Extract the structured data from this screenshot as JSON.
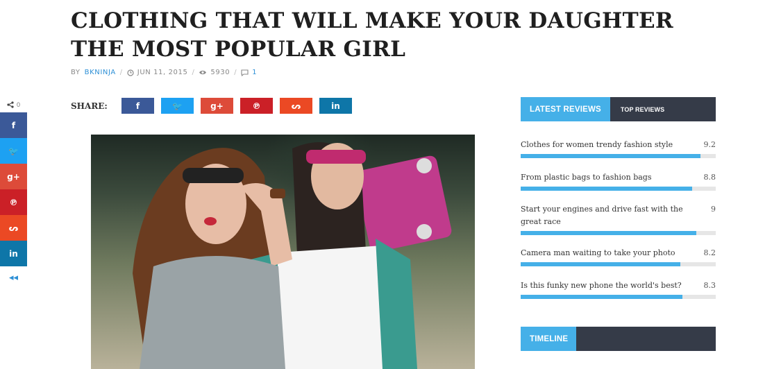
{
  "article": {
    "title": "CLOTHING THAT WILL MAKE YOUR DAUGHTER THE MOST POPULAR GIRL",
    "meta": {
      "by_label": "BY",
      "author": "BKNINJA",
      "date": "JUN 11, 2015",
      "views": "5930",
      "comments": "1",
      "separator": "/"
    }
  },
  "float_share": {
    "count": "0",
    "buttons": [
      {
        "name": "facebook",
        "glyph": "f",
        "color": "#3b5998"
      },
      {
        "name": "twitter",
        "glyph": "🐦",
        "color": "#1da1f2"
      },
      {
        "name": "googleplus",
        "glyph": "g+",
        "color": "#dd4b39"
      },
      {
        "name": "pinterest",
        "glyph": "℗",
        "color": "#cb2027"
      },
      {
        "name": "stumbleupon",
        "glyph": "ᔕ",
        "color": "#eb4924"
      },
      {
        "name": "linkedin",
        "glyph": "in",
        "color": "#0e76a8"
      }
    ],
    "collapse_glyph": "◂◂"
  },
  "share": {
    "label": "SHARE:",
    "buttons": [
      {
        "name": "facebook",
        "glyph": "f",
        "color": "#3b5998"
      },
      {
        "name": "twitter",
        "glyph": "🐦",
        "color": "#1da1f2"
      },
      {
        "name": "googleplus",
        "glyph": "g+",
        "color": "#dd4b39"
      },
      {
        "name": "pinterest",
        "glyph": "℗",
        "color": "#cb2027"
      },
      {
        "name": "stumbleupon",
        "glyph": "ᔕ",
        "color": "#eb4924"
      },
      {
        "name": "linkedin",
        "glyph": "in",
        "color": "#0e76a8"
      }
    ]
  },
  "sidebar": {
    "reviews_widget": {
      "tab_active": "LATEST REVIEWS",
      "tab_inactive": "TOP REVIEWS",
      "items": [
        {
          "title": "Clothes for women trendy fashion style",
          "score": "9.2",
          "fill": 0.92
        },
        {
          "title": "From plastic bags to fashion bags",
          "score": "8.8",
          "fill": 0.88
        },
        {
          "title": "Start your engines and drive fast with the great race",
          "score": "9",
          "fill": 0.9
        },
        {
          "title": "Camera man waiting to take your photo",
          "score": "8.2",
          "fill": 0.82
        },
        {
          "title": "Is this funky new phone the world's best?",
          "score": "8.3",
          "fill": 0.83
        }
      ]
    },
    "timeline_widget": {
      "title": "TIMELINE"
    }
  },
  "colors": {
    "accent": "#45b0e8",
    "widget_dark": "#353b48",
    "link": "#2c8fd6"
  }
}
